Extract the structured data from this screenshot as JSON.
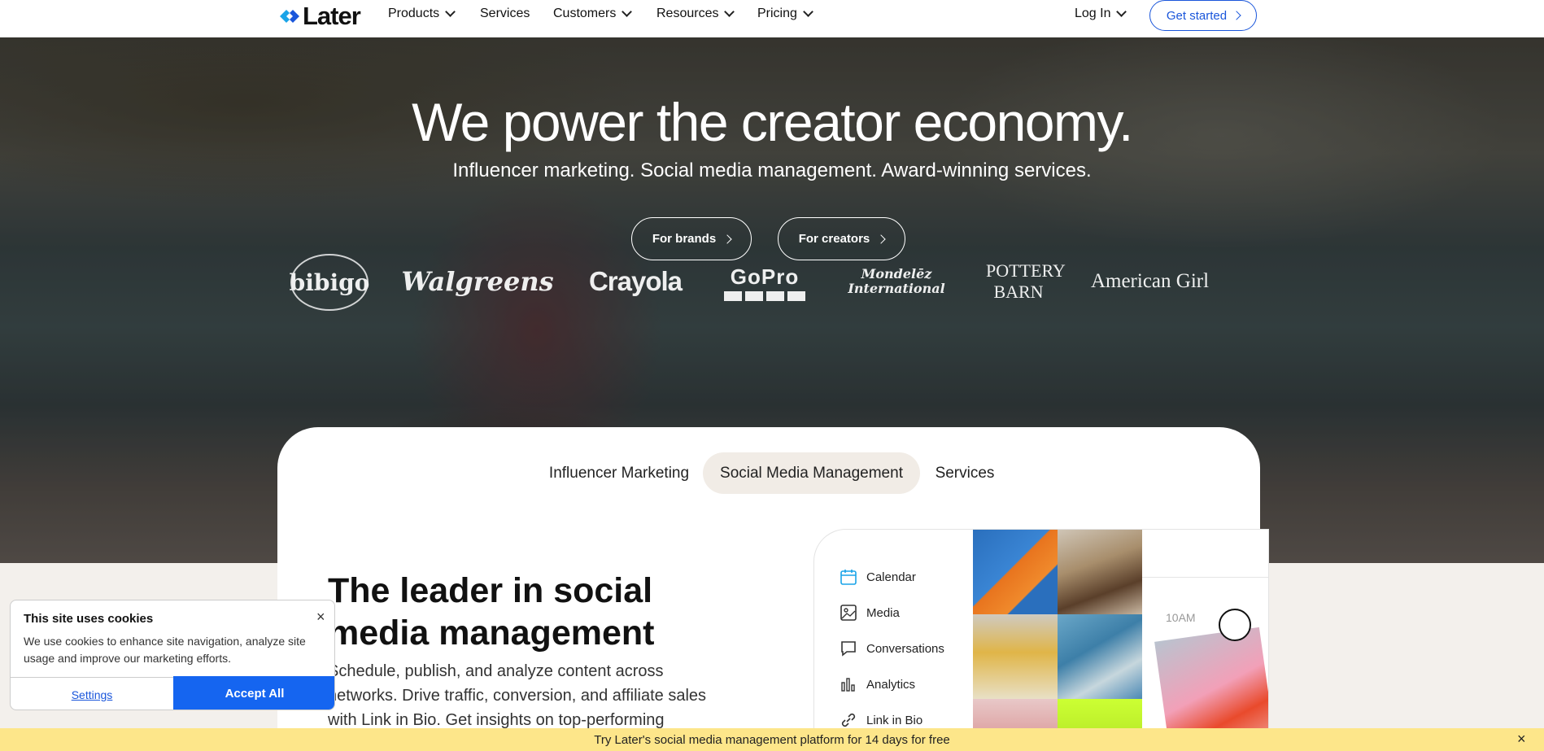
{
  "nav": {
    "logo_text": "Later",
    "items": [
      {
        "label": "Products",
        "has_dropdown": true
      },
      {
        "label": "Services",
        "has_dropdown": false
      },
      {
        "label": "Customers",
        "has_dropdown": true
      },
      {
        "label": "Resources",
        "has_dropdown": true
      },
      {
        "label": "Pricing",
        "has_dropdown": true
      }
    ],
    "login_label": "Log In",
    "cta_label": "Get started"
  },
  "hero": {
    "title": "We power the creator economy.",
    "subtitle": "Influencer marketing. Social media management. Award-winning services.",
    "buttons": [
      {
        "label": "For brands"
      },
      {
        "label": "For creators"
      }
    ],
    "brands": [
      "bibigo",
      "Walgreens",
      "Crayola",
      "GoPro",
      "Mondelēz International",
      "Pottery Barn",
      "American Girl"
    ]
  },
  "tabs": [
    {
      "label": "Influencer Marketing",
      "active": false
    },
    {
      "label": "Social Media Management",
      "active": true
    },
    {
      "label": "Services",
      "active": false
    }
  ],
  "feature": {
    "title": "The leader in social media management",
    "text": "Schedule, publish, and analyze content across networks. Drive traffic, conversion, and affiliate sales with Link in Bio. Get insights on top-performing"
  },
  "app_mock": {
    "menu": [
      {
        "label": "Calendar",
        "icon": "calendar-icon"
      },
      {
        "label": "Media",
        "icon": "image-icon"
      },
      {
        "label": "Conversations",
        "icon": "chat-icon"
      },
      {
        "label": "Analytics",
        "icon": "bar-chart-icon"
      },
      {
        "label": "Link in Bio",
        "icon": "link-icon"
      }
    ],
    "time_label": "10AM"
  },
  "cookie": {
    "title": "This site uses cookies",
    "text": "We use cookies to enhance site navigation, analyze site usage and improve our marketing efforts.",
    "settings_label": "Settings",
    "accept_label": "Accept All",
    "close_glyph": "×"
  },
  "promo": {
    "text": "Try Later's social media management platform for 14 days for free",
    "close_glyph": "×"
  },
  "colors": {
    "accent": "#1565f0",
    "brand_blue": "#1a56db",
    "promo_bg": "#fde68a",
    "tab_active_bg": "#f1ece6",
    "logo_mark": "#1aa4e8"
  }
}
